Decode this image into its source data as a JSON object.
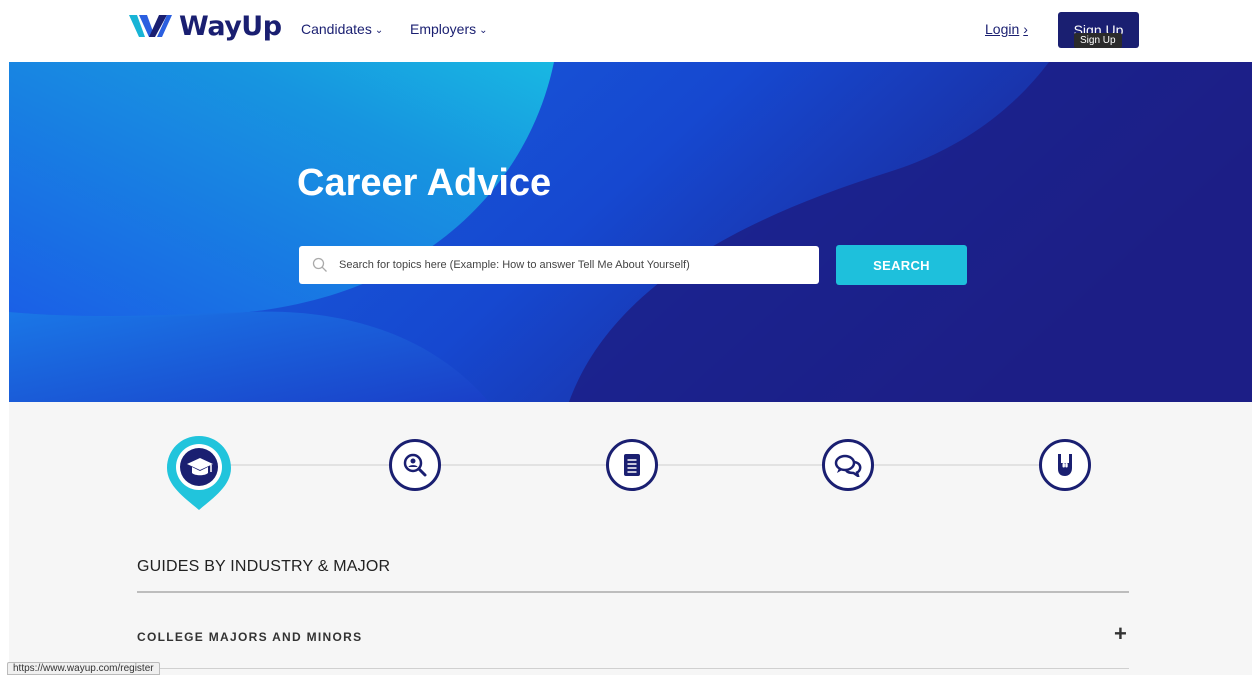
{
  "header": {
    "brand": "WayUp",
    "nav": [
      {
        "label": "Candidates"
      },
      {
        "label": "Employers"
      }
    ],
    "login_label": "Login",
    "login_arrow": "›",
    "signup_label": "Sign Up",
    "tooltip": "Sign Up"
  },
  "hero": {
    "title": "Career Advice",
    "search_placeholder": "Search for topics here (Example: How to answer Tell Me About Yourself)",
    "search_button": "SEARCH"
  },
  "steps": [
    {
      "icon": "graduation-cap-icon"
    },
    {
      "icon": "magnifier-person-icon"
    },
    {
      "icon": "document-icon"
    },
    {
      "icon": "chat-bubbles-icon"
    },
    {
      "icon": "rock-hand-icon"
    }
  ],
  "guides": {
    "title": "GUIDES BY INDUSTRY & MAJOR",
    "items": [
      {
        "label": "COLLEGE MAJORS AND MINORS",
        "toggle": "+"
      }
    ]
  },
  "status_url": "https://www.wayup.com/register",
  "colors": {
    "navy": "#1a1f71",
    "hero_blue": "#1c1f86",
    "accent_cyan": "#1ec0dc"
  }
}
